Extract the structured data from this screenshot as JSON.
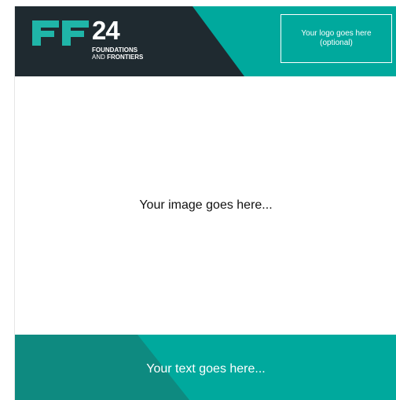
{
  "brand": {
    "number": "24",
    "line1": "FOUNDATIONS",
    "line2_prefix": "AND ",
    "line2_bold": "FRONTIERS",
    "mark_icon": "ff-brand-mark-icon"
  },
  "logo_placeholder": {
    "line1": "Your logo goes here",
    "line2": "(optional)"
  },
  "image_placeholder": {
    "text": "Your image goes here..."
  },
  "footer": {
    "text": "Your text goes here..."
  },
  "colors": {
    "dark": "#1f2a30",
    "teal": "#00a99d",
    "teal_dark": "#0e8a80",
    "mark": "#1fb5a8"
  }
}
